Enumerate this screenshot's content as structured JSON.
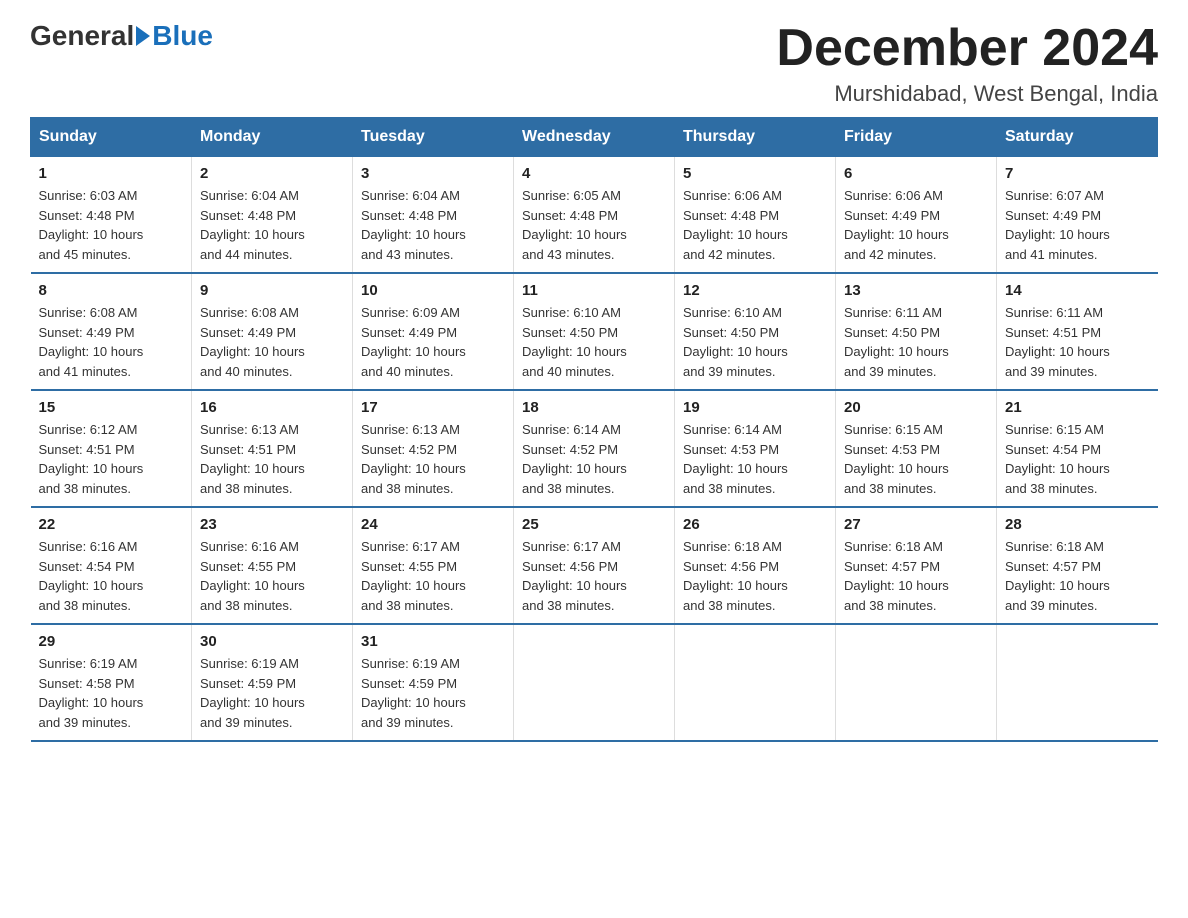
{
  "header": {
    "title": "December 2024",
    "subtitle": "Murshidabad, West Bengal, India",
    "logo_general": "General",
    "logo_blue": "Blue"
  },
  "days_of_week": [
    "Sunday",
    "Monday",
    "Tuesday",
    "Wednesday",
    "Thursday",
    "Friday",
    "Saturday"
  ],
  "weeks": [
    [
      {
        "day": "1",
        "sunrise": "6:03 AM",
        "sunset": "4:48 PM",
        "daylight": "10 hours and 45 minutes."
      },
      {
        "day": "2",
        "sunrise": "6:04 AM",
        "sunset": "4:48 PM",
        "daylight": "10 hours and 44 minutes."
      },
      {
        "day": "3",
        "sunrise": "6:04 AM",
        "sunset": "4:48 PM",
        "daylight": "10 hours and 43 minutes."
      },
      {
        "day": "4",
        "sunrise": "6:05 AM",
        "sunset": "4:48 PM",
        "daylight": "10 hours and 43 minutes."
      },
      {
        "day": "5",
        "sunrise": "6:06 AM",
        "sunset": "4:48 PM",
        "daylight": "10 hours and 42 minutes."
      },
      {
        "day": "6",
        "sunrise": "6:06 AM",
        "sunset": "4:49 PM",
        "daylight": "10 hours and 42 minutes."
      },
      {
        "day": "7",
        "sunrise": "6:07 AM",
        "sunset": "4:49 PM",
        "daylight": "10 hours and 41 minutes."
      }
    ],
    [
      {
        "day": "8",
        "sunrise": "6:08 AM",
        "sunset": "4:49 PM",
        "daylight": "10 hours and 41 minutes."
      },
      {
        "day": "9",
        "sunrise": "6:08 AM",
        "sunset": "4:49 PM",
        "daylight": "10 hours and 40 minutes."
      },
      {
        "day": "10",
        "sunrise": "6:09 AM",
        "sunset": "4:49 PM",
        "daylight": "10 hours and 40 minutes."
      },
      {
        "day": "11",
        "sunrise": "6:10 AM",
        "sunset": "4:50 PM",
        "daylight": "10 hours and 40 minutes."
      },
      {
        "day": "12",
        "sunrise": "6:10 AM",
        "sunset": "4:50 PM",
        "daylight": "10 hours and 39 minutes."
      },
      {
        "day": "13",
        "sunrise": "6:11 AM",
        "sunset": "4:50 PM",
        "daylight": "10 hours and 39 minutes."
      },
      {
        "day": "14",
        "sunrise": "6:11 AM",
        "sunset": "4:51 PM",
        "daylight": "10 hours and 39 minutes."
      }
    ],
    [
      {
        "day": "15",
        "sunrise": "6:12 AM",
        "sunset": "4:51 PM",
        "daylight": "10 hours and 38 minutes."
      },
      {
        "day": "16",
        "sunrise": "6:13 AM",
        "sunset": "4:51 PM",
        "daylight": "10 hours and 38 minutes."
      },
      {
        "day": "17",
        "sunrise": "6:13 AM",
        "sunset": "4:52 PM",
        "daylight": "10 hours and 38 minutes."
      },
      {
        "day": "18",
        "sunrise": "6:14 AM",
        "sunset": "4:52 PM",
        "daylight": "10 hours and 38 minutes."
      },
      {
        "day": "19",
        "sunrise": "6:14 AM",
        "sunset": "4:53 PM",
        "daylight": "10 hours and 38 minutes."
      },
      {
        "day": "20",
        "sunrise": "6:15 AM",
        "sunset": "4:53 PM",
        "daylight": "10 hours and 38 minutes."
      },
      {
        "day": "21",
        "sunrise": "6:15 AM",
        "sunset": "4:54 PM",
        "daylight": "10 hours and 38 minutes."
      }
    ],
    [
      {
        "day": "22",
        "sunrise": "6:16 AM",
        "sunset": "4:54 PM",
        "daylight": "10 hours and 38 minutes."
      },
      {
        "day": "23",
        "sunrise": "6:16 AM",
        "sunset": "4:55 PM",
        "daylight": "10 hours and 38 minutes."
      },
      {
        "day": "24",
        "sunrise": "6:17 AM",
        "sunset": "4:55 PM",
        "daylight": "10 hours and 38 minutes."
      },
      {
        "day": "25",
        "sunrise": "6:17 AM",
        "sunset": "4:56 PM",
        "daylight": "10 hours and 38 minutes."
      },
      {
        "day": "26",
        "sunrise": "6:18 AM",
        "sunset": "4:56 PM",
        "daylight": "10 hours and 38 minutes."
      },
      {
        "day": "27",
        "sunrise": "6:18 AM",
        "sunset": "4:57 PM",
        "daylight": "10 hours and 38 minutes."
      },
      {
        "day": "28",
        "sunrise": "6:18 AM",
        "sunset": "4:57 PM",
        "daylight": "10 hours and 39 minutes."
      }
    ],
    [
      {
        "day": "29",
        "sunrise": "6:19 AM",
        "sunset": "4:58 PM",
        "daylight": "10 hours and 39 minutes."
      },
      {
        "day": "30",
        "sunrise": "6:19 AM",
        "sunset": "4:59 PM",
        "daylight": "10 hours and 39 minutes."
      },
      {
        "day": "31",
        "sunrise": "6:19 AM",
        "sunset": "4:59 PM",
        "daylight": "10 hours and 39 minutes."
      },
      null,
      null,
      null,
      null
    ]
  ],
  "labels": {
    "sunrise": "Sunrise:",
    "sunset": "Sunset:",
    "daylight": "Daylight:"
  }
}
